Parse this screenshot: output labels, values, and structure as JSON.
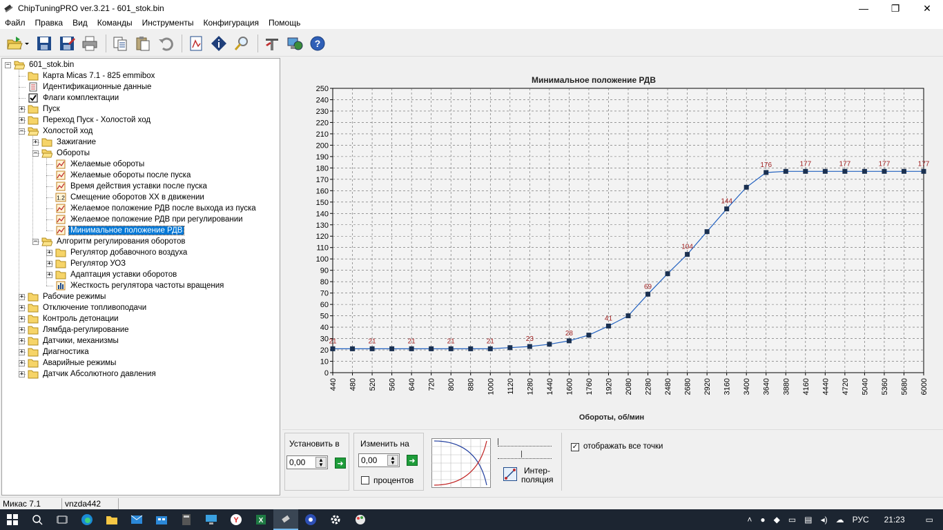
{
  "window": {
    "title": "ChipTuningPRO ver.3.21 - 601_stok.bin",
    "minimize": "—",
    "maximize": "❐",
    "close": "✕"
  },
  "menu": [
    "Файл",
    "Правка",
    "Вид",
    "Команды",
    "Инструменты",
    "Конфигурация",
    "Помощь"
  ],
  "toolbar": {
    "icons": [
      "open-icon",
      "save-icon",
      "save-as-icon",
      "print-icon",
      "copy-icon",
      "paste-icon",
      "undo-icon",
      "calc-icon",
      "info-icon",
      "search-icon",
      "tools-icon",
      "network-icon",
      "help-icon"
    ]
  },
  "tree": {
    "items": [
      {
        "label": "601_stok.bin",
        "level": 0,
        "exp": "-",
        "icon": "folder-open"
      },
      {
        "label": "Карта Micas 7.1 - 825 emmibox",
        "level": 1,
        "exp": "",
        "icon": "folder"
      },
      {
        "label": "Идентификационные данные",
        "level": 1,
        "exp": "",
        "icon": "doc"
      },
      {
        "label": "Флаги комплектации",
        "level": 1,
        "exp": "",
        "icon": "check"
      },
      {
        "label": "Пуск",
        "level": 1,
        "exp": "+",
        "icon": "folder"
      },
      {
        "label": "Переход Пуск - Холостой ход",
        "level": 1,
        "exp": "+",
        "icon": "folder"
      },
      {
        "label": "Холостой ход",
        "level": 1,
        "exp": "-",
        "icon": "folder-open"
      },
      {
        "label": "Зажигание",
        "level": 2,
        "exp": "+",
        "icon": "folder"
      },
      {
        "label": "Обороты",
        "level": 2,
        "exp": "-",
        "icon": "folder-open"
      },
      {
        "label": "Желаемые обороты",
        "level": 3,
        "exp": "",
        "icon": "chart"
      },
      {
        "label": "Желаемые обороты после пуска",
        "level": 3,
        "exp": "",
        "icon": "chart"
      },
      {
        "label": "Время действия уставки после пуска",
        "level": 3,
        "exp": "",
        "icon": "chart"
      },
      {
        "label": "Смещение оборотов ХХ в движении",
        "level": 3,
        "exp": "",
        "icon": "num"
      },
      {
        "label": "Желаемое положение РДВ после выхода из пуска",
        "level": 3,
        "exp": "",
        "icon": "chart"
      },
      {
        "label": "Желаемое положение РДВ при регулировании",
        "level": 3,
        "exp": "",
        "icon": "chart"
      },
      {
        "label": "Минимальное положение РДВ",
        "level": 3,
        "exp": "",
        "icon": "chart",
        "selected": true
      },
      {
        "label": "Алгоритм регулирования оборотов",
        "level": 2,
        "exp": "-",
        "icon": "folder-open"
      },
      {
        "label": "Регулятор добавочного воздуха",
        "level": 3,
        "exp": "+",
        "icon": "folder"
      },
      {
        "label": "Регулятор УОЗ",
        "level": 3,
        "exp": "+",
        "icon": "folder"
      },
      {
        "label": "Адаптация уставки оборотов",
        "level": 3,
        "exp": "+",
        "icon": "folder"
      },
      {
        "label": "Жесткость регулятора частоты вращения",
        "level": 3,
        "exp": "",
        "icon": "bars"
      },
      {
        "label": "Рабочие режимы",
        "level": 1,
        "exp": "+",
        "icon": "folder"
      },
      {
        "label": "Отключение топливоподачи",
        "level": 1,
        "exp": "+",
        "icon": "folder"
      },
      {
        "label": "Контроль детонации",
        "level": 1,
        "exp": "+",
        "icon": "folder"
      },
      {
        "label": "Лямбда-регулирование",
        "level": 1,
        "exp": "+",
        "icon": "folder"
      },
      {
        "label": "Датчики, механизмы",
        "level": 1,
        "exp": "+",
        "icon": "folder"
      },
      {
        "label": "Диагностика",
        "level": 1,
        "exp": "+",
        "icon": "folder"
      },
      {
        "label": "Аварийные режимы",
        "level": 1,
        "exp": "+",
        "icon": "folder"
      },
      {
        "label": "Датчик Абсолютного давления",
        "level": 1,
        "exp": "+",
        "icon": "folder"
      }
    ]
  },
  "chart_data": {
    "type": "line",
    "title": "Минимальное положение РДВ",
    "xlabel": "Обороты, об/мин",
    "ylabel": "",
    "x": [
      440,
      480,
      520,
      560,
      640,
      720,
      800,
      880,
      1000,
      1120,
      1280,
      1440,
      1600,
      1760,
      1920,
      2080,
      2280,
      2480,
      2680,
      2920,
      3160,
      3400,
      3640,
      3880,
      4160,
      4440,
      4720,
      5040,
      5360,
      5680,
      6000
    ],
    "y": [
      21,
      21,
      21,
      21,
      21,
      21,
      21,
      21,
      21,
      22,
      23,
      25,
      28,
      33,
      41,
      50,
      69,
      87,
      104,
      124,
      144,
      163,
      176,
      177,
      177,
      177,
      177,
      177,
      177,
      177,
      177
    ],
    "point_labels": [
      {
        "index": 0,
        "text": "21"
      },
      {
        "index": 2,
        "text": "21"
      },
      {
        "index": 4,
        "text": "21"
      },
      {
        "index": 6,
        "text": "21"
      },
      {
        "index": 8,
        "text": "21"
      },
      {
        "index": 10,
        "text": "23"
      },
      {
        "index": 12,
        "text": "28"
      },
      {
        "index": 14,
        "text": "41"
      },
      {
        "index": 16,
        "text": "69"
      },
      {
        "index": 18,
        "text": "104"
      },
      {
        "index": 20,
        "text": "144"
      },
      {
        "index": 22,
        "text": "176"
      },
      {
        "index": 24,
        "text": "177"
      },
      {
        "index": 26,
        "text": "177"
      },
      {
        "index": 28,
        "text": "177"
      },
      {
        "index": 30,
        "text": "177"
      }
    ],
    "ylim": [
      0,
      250
    ],
    "yticks": [
      0,
      10,
      20,
      30,
      40,
      50,
      60,
      70,
      80,
      90,
      100,
      110,
      120,
      130,
      140,
      150,
      160,
      170,
      180,
      190,
      200,
      210,
      220,
      230,
      240,
      250
    ],
    "grid": true,
    "line_color": "#1f5fbf",
    "marker_color": "#1a3050",
    "label_color": "#a02020"
  },
  "controls": {
    "set_label": "Установить в",
    "set_value": "0,00",
    "change_label": "Изменить на",
    "change_value": "0,00",
    "percent_label": "процентов",
    "interp_label_1": "Интер-",
    "interp_label_2": "поляция",
    "show_all_label": "отображать все точки",
    "show_all_checked": "✓"
  },
  "status": {
    "left": "Микас 7.1",
    "right": "vnzda442"
  },
  "taskbar": {
    "lang": "РУС",
    "time": "21:23"
  }
}
